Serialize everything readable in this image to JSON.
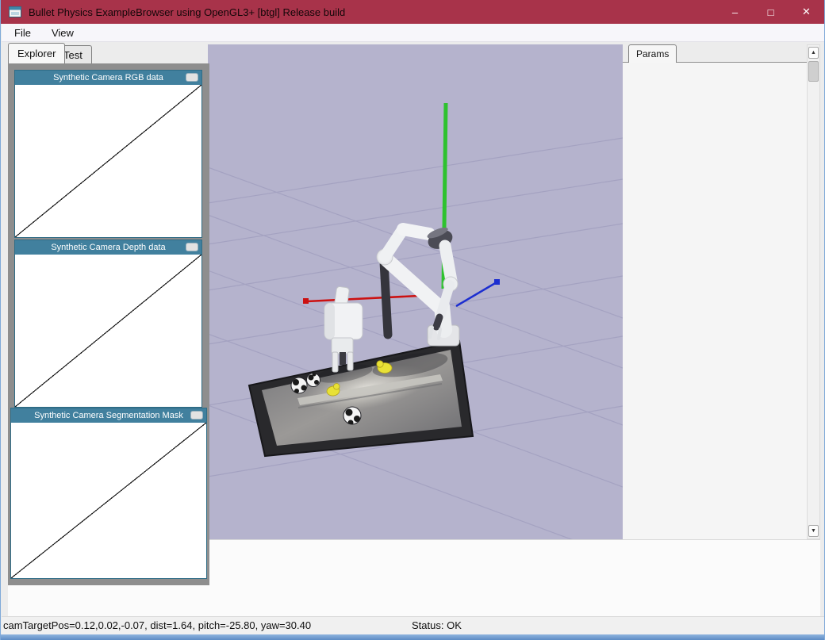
{
  "window": {
    "title": "Bullet Physics ExampleBrowser using OpenGL3+ [btgl] Release build",
    "controls": {
      "minimize": "–",
      "maximize": "□",
      "close": "✕"
    }
  },
  "menubar": {
    "items": [
      "File",
      "View"
    ]
  },
  "left_tabs": {
    "tabs": [
      "Explorer",
      "Test"
    ],
    "active": "Explorer"
  },
  "camera_windows": [
    {
      "title": "Synthetic Camera RGB data"
    },
    {
      "title": "Synthetic Camera Depth data"
    },
    {
      "title": "Synthetic Camera Segmentation Mask"
    }
  ],
  "params_panel": {
    "tab_label": "Params"
  },
  "scrollbar": {
    "up_glyph": "▲",
    "down_glyph": "▼"
  },
  "statusbar": {
    "camera_text": "camTargetPos=0.12,0.02,-0.07, dist=1.64, pitch=-25.80, yaw=30.40",
    "status_text": "Status: OK"
  },
  "viewport": {
    "background": "#b5b3cd",
    "axes": {
      "x_color": "#cc1111",
      "y_color": "#2ec22e",
      "z_color": "#1c2ed0"
    },
    "objects": [
      "ground-grid",
      "tray",
      "robot-arm",
      "gripper-robot",
      "checkered-balls",
      "yellow-ducks",
      "world-axes"
    ]
  },
  "colors": {
    "titlebar": "#a8334a",
    "camera_titlebar": "#41809e",
    "window_frame": "#7fa9d9"
  }
}
